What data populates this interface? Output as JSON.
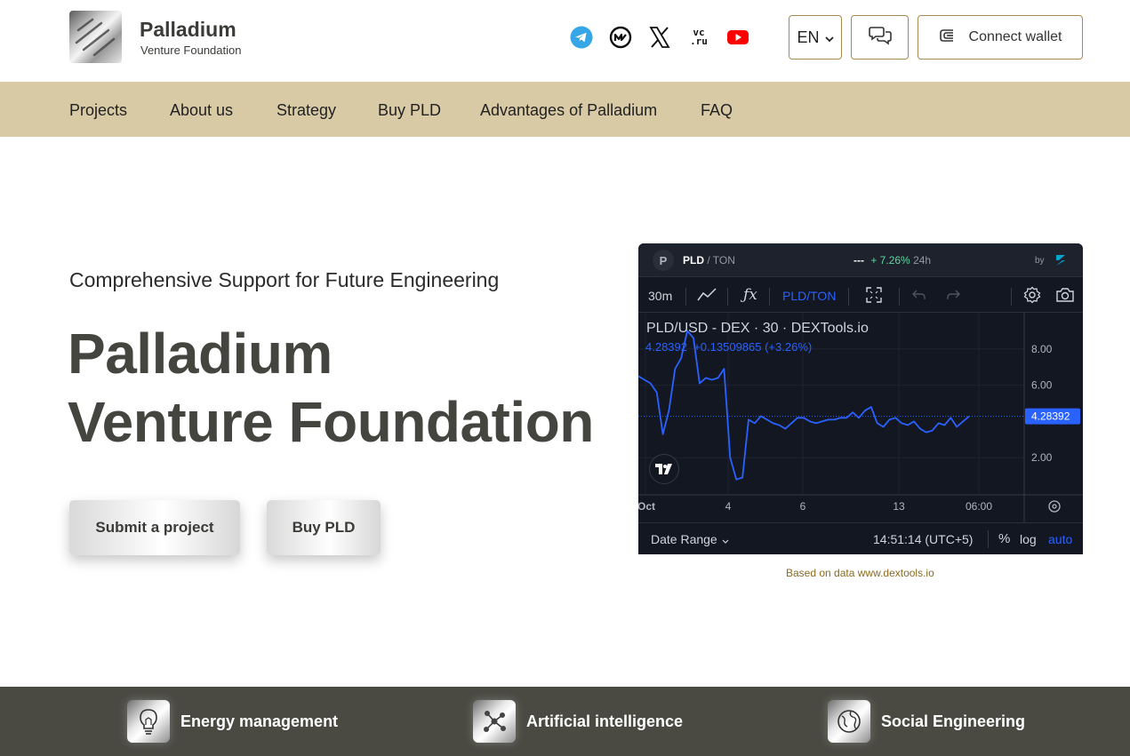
{
  "brand": {
    "title": "Palladium",
    "subtitle": "Venture Foundation"
  },
  "social": {
    "vc_line1": "vc",
    "vc_line2": ".ru"
  },
  "header": {
    "language": "EN",
    "connect_wallet": "Connect wallet"
  },
  "nav": [
    {
      "label": "Projects"
    },
    {
      "label": "About us"
    },
    {
      "label": "Strategy"
    },
    {
      "label": "Buy PLD"
    },
    {
      "label": "Advantages of Palladium"
    },
    {
      "label": "FAQ"
    }
  ],
  "hero": {
    "tagline": "Comprehensive Support for Future Engineering",
    "title_line1": "Palladium",
    "title_line2": "Venture Foundation",
    "submit_label": "Submit a project",
    "buy_label": "Buy PLD"
  },
  "widget": {
    "avatar_letter": "P",
    "pair_base": "PLD",
    "pair_quote": "/ TON",
    "price_placeholder": "---",
    "change": "+ 7.26%",
    "period": "24h",
    "by": "by",
    "interval": "30m",
    "fx_label": "ƒx",
    "toolbar_pair": "PLD/TON",
    "title": "PLD/USD - DEX · 30 · DEXTools.io",
    "ohlc": "4.28392  +0.13509865 (+3.26%)",
    "date_range": "Date Range",
    "time": "14:51:14 (UTC+5)",
    "percent": "%",
    "log": "log",
    "auto": "auto",
    "colors": {
      "line": "#2962ff",
      "bg": "#131722",
      "label_bg": "#2962ff"
    }
  },
  "chart_data": {
    "type": "line",
    "title": "PLD/USD - DEX · 30 · DEXTools.io",
    "x_ticks": [
      "Oct",
      "4",
      "6",
      "13",
      "06:00"
    ],
    "y_ticks": [
      8.0,
      6.0,
      2.0
    ],
    "ylim": [
      0,
      10
    ],
    "last_value": 4.28392,
    "last_label": "4.28392",
    "grid": true,
    "series": [
      {
        "values": [
          6.5,
          6.3,
          6.1,
          5.6,
          3.3,
          4.6,
          6.9,
          7.5,
          9.0,
          8.6,
          6.1,
          6.4,
          6.3,
          6.4,
          6.9,
          2.0,
          0.8,
          0.9,
          4.1,
          3.9,
          4.3,
          4.1,
          3.9,
          3.8,
          3.6,
          3.9,
          4.2,
          4.2,
          4.0,
          3.9,
          4.0,
          4.1,
          4.1,
          4.2,
          4.2,
          4.5,
          4.2,
          4.6,
          4.8,
          3.9,
          3.7,
          4.1,
          4.2,
          3.9,
          3.8,
          4.0,
          3.6,
          3.4,
          3.5,
          3.9,
          3.8,
          4.2,
          3.7,
          4.0,
          4.28
        ]
      }
    ]
  },
  "based_on": "Based on data www.dextools.io",
  "categories": [
    {
      "label": "Energy management"
    },
    {
      "label": "Artificial intelligence"
    },
    {
      "label": "Social Engineering"
    }
  ]
}
